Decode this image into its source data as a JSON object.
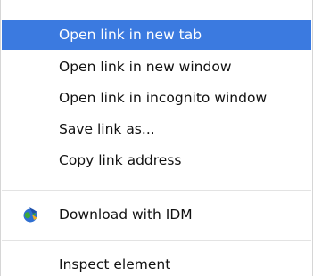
{
  "context_menu": {
    "items": [
      {
        "label": "Open link in new tab",
        "selected": true
      },
      {
        "label": "Open link in new window"
      },
      {
        "label": "Open link in incognito window"
      },
      {
        "label": "Save link as..."
      },
      {
        "label": "Copy link address"
      },
      {
        "label": "Download with IDM",
        "icon": "idm-globe-icon"
      },
      {
        "label": "Inspect element"
      }
    ]
  },
  "colors": {
    "selection_background": "#3b7ae0",
    "selection_text": "#ffffff",
    "text": "#111111",
    "separator": "#e3e3e3"
  }
}
